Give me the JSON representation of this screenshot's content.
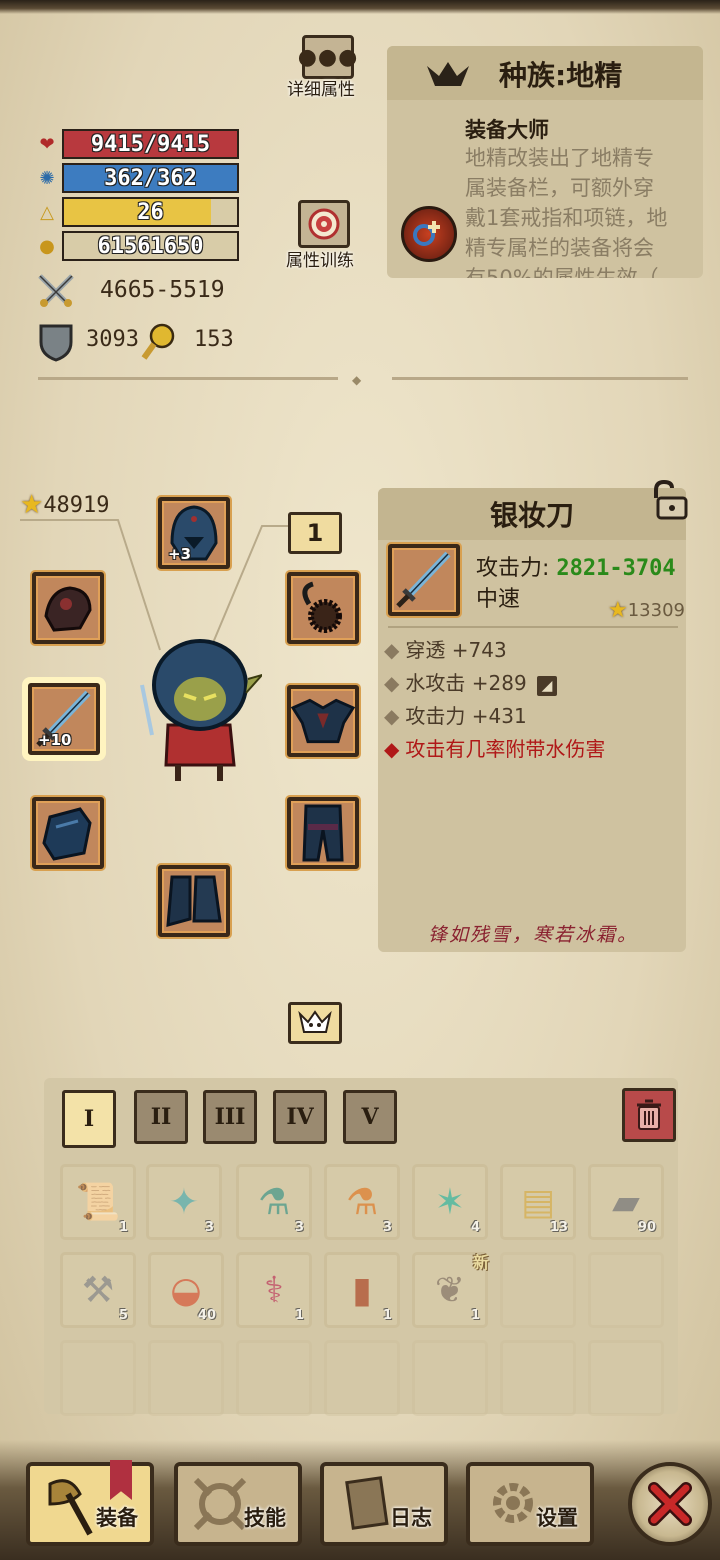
{
  "stats": {
    "hp": "9415/9415",
    "mp": "362/362",
    "level": "26",
    "gold": "61561650",
    "attack": "4665-5519",
    "armor": "3093",
    "luck": "153",
    "xp_fill": 0.85
  },
  "buttons": {
    "detail_attributes": "详细属性",
    "attribute_training": "属性训练"
  },
  "race": {
    "title": "种族:地精",
    "ability_name": "装备大师",
    "ability_desc": "地精改装出了地精专属装备栏，可额外穿戴1套戒指和项链，地精专属栏的装备将会有50%的属性生效（"
  },
  "character": {
    "score": "48919",
    "helmet_plus": "+3",
    "weapon_plus": "+10",
    "set_badge": "1"
  },
  "item": {
    "name": "银妆刀",
    "attack_label": "攻击力:",
    "attack_value": "2821-3704",
    "speed": "中速",
    "score": "13309",
    "stats": [
      "穿透 +743",
      "水攻击 +289",
      "攻击力 +431"
    ],
    "special": "攻击有几率附带水伤害",
    "flavor": "锋如残雪，寒若冰霜。"
  },
  "bag_tabs": [
    "I",
    "II",
    "III",
    "IV",
    "V"
  ],
  "inventory": [
    {
      "q": "1"
    },
    {
      "q": "3"
    },
    {
      "q": "3"
    },
    {
      "q": "3"
    },
    {
      "q": "4"
    },
    {
      "q": "13"
    },
    {
      "q": "90"
    },
    {
      "q": "5"
    },
    {
      "q": "40"
    },
    {
      "q": "1"
    },
    {
      "q": "1"
    },
    {
      "q": "1"
    }
  ],
  "new_badge": "新",
  "nav": {
    "equipment": "装备",
    "skills": "技能",
    "log": "日志",
    "settings": "设置"
  }
}
